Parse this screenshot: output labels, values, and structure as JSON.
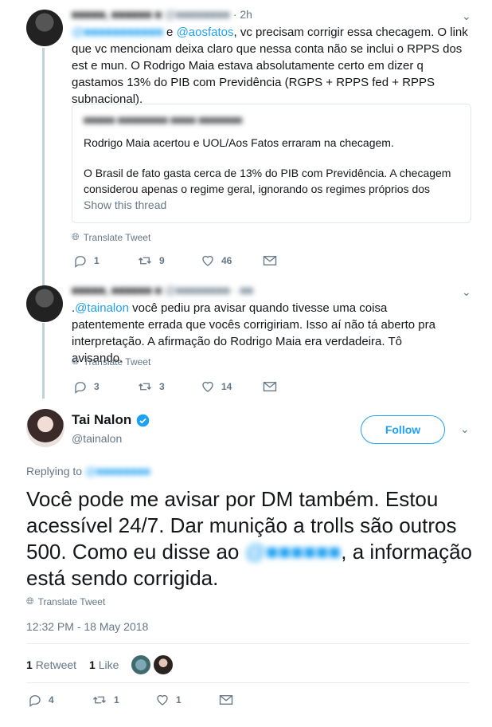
{
  "tweet1": {
    "meta": "· 2h",
    "text_line1_prefix": " e ",
    "text_line1_mention": "@aosfatos",
    "text_line1_suffix": ", vc precisam corrigir essa checagem. O link que",
    "text_rest": "vc mencionam deixa claro que nessa conta não se inclui o RPPS dos est e mun. O Rodrigo Maia estava absolutamente certo em dizer q gastamos 13% do PIB com Previdência (RGPS + RPPS fed + RPPS subnacional).",
    "quote": {
      "line1": "Rodrigo Maia acertou e UOL/Aos Fatos erraram na checagem.",
      "line2": "O Brasil de fato gasta cerca de 13% do PIB com Previdência. A checagem considerou apenas o regime geral, ignorando os regimes próprios dos",
      "show_thread": "Show this thread"
    },
    "translate": "Translate Tweet",
    "replies": "1",
    "retweets": "9",
    "likes": "46"
  },
  "tweet2": {
    "text_prefix": ".",
    "mention": "@tainalon",
    "text": " você pediu pra avisar quando tivesse uma coisa patentemente errada que vocês corrigiriam. Isso aí não tá aberto pra interpretação. A afirmação do Rodrigo Maia era verdadeira. Tô avisando.",
    "translate": "Translate Tweet",
    "replies": "3",
    "retweets": "3",
    "likes": "14"
  },
  "main": {
    "name": "Tai Nalon",
    "handle": "@tainalon",
    "follow": "Follow",
    "replying_to": "Replying to",
    "text_before": "Você pode me avisar por DM também. Estou acessível 24/7. Dar munição a trolls são outros 500. Como eu disse ao ",
    "text_after": ", a informação está sendo corrigida.",
    "translate": "Translate Tweet",
    "timestamp": "12:32 PM - 18 May 2018",
    "retweet_count": "1",
    "retweet_label": "Retweet",
    "like_count": "1",
    "like_label": "Like",
    "replies": "4",
    "retweets": "1",
    "likes": "1"
  },
  "colors": {
    "accent": "#1da1f2",
    "muted": "#657786",
    "verified": "#1da1f2"
  }
}
